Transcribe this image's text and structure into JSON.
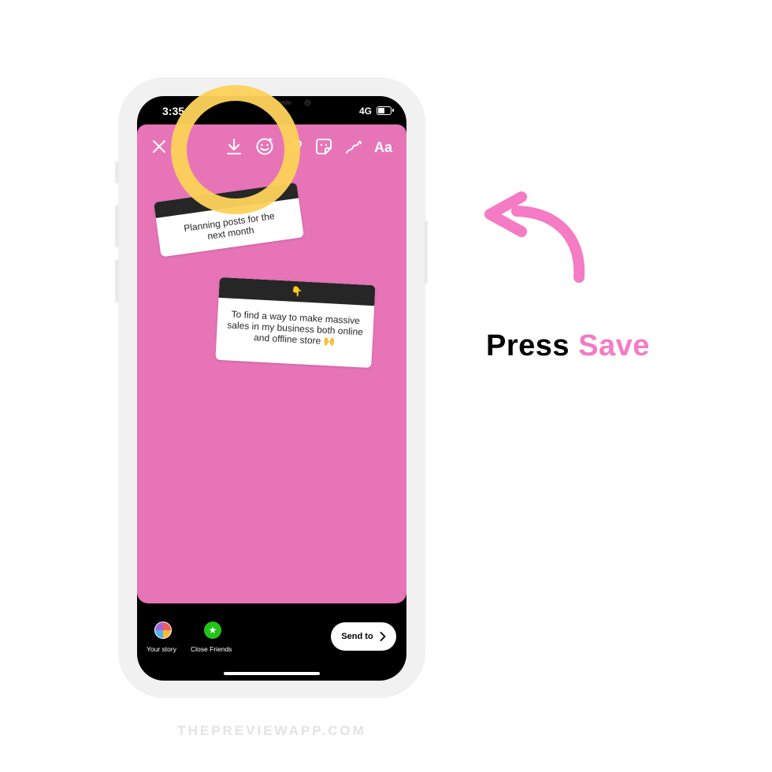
{
  "colors": {
    "canvas": "#e874b8",
    "accent_pink": "#f57bc4",
    "highlight": "#fcd15a"
  },
  "status_bar": {
    "time": "3:35",
    "network": "4G",
    "battery_level": 0.5
  },
  "toolbar": {
    "close_icon": "close-icon",
    "download_icon": "download-icon",
    "face_effects_icon": "face-effects-icon",
    "link_icon": "link-icon",
    "sticker_icon": "sticker-icon",
    "draw_icon": "draw-icon",
    "text_label": "Aa"
  },
  "cards": [
    {
      "header": "",
      "body_lines": [
        "Planning posts for the",
        "next month"
      ]
    },
    {
      "header": "👇",
      "body_lines": [
        "To find a way to make massive",
        "sales in my business both online",
        "and offline store 🙌"
      ]
    }
  ],
  "bottom": {
    "your_story_label": "Your story",
    "close_friends_label": "Close Friends",
    "close_friends_icon": "star-icon",
    "send_label": "Send to",
    "send_icon": "chevron-right-icon"
  },
  "annotation": {
    "word1": "Press",
    "word2": "Save",
    "arrow_icon": "curved-arrow-icon"
  },
  "watermark": "THEPREVIEWAPP.COM"
}
